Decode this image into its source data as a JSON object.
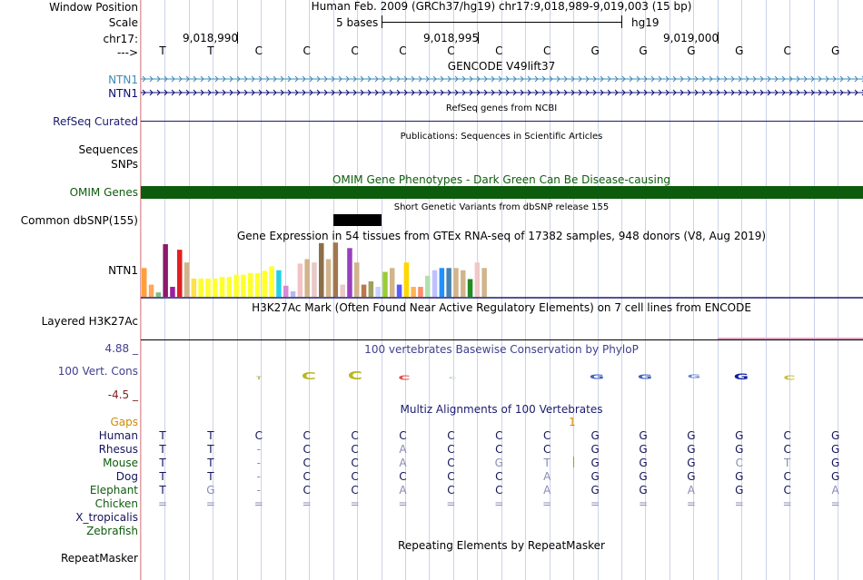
{
  "labels": {
    "window_position": "Window Position",
    "scale": "Scale",
    "chrom": "chr17:",
    "strand": "--->",
    "ntn1_a": "NTN1",
    "ntn1_b": "NTN1",
    "refseq": "RefSeq Curated",
    "sequences": "Sequences",
    "snps": "SNPs",
    "omim": "OMIM Genes",
    "dbsnp": "Common dbSNP(155)",
    "gtex": "NTN1",
    "h3k27ac": "Layered H3K27Ac",
    "cons_max": "4.88 _",
    "cons": "100 Vert. Cons",
    "cons_min": "-4.5 _",
    "gaps": "Gaps",
    "repeatmasker": "RepeatMasker"
  },
  "header": {
    "position": "Human Feb. 2009 (GRCh37/hg19)   chr17:9,018,989-9,019,003 (15 bp)",
    "scale_text": "5 bases",
    "assembly": "hg19",
    "coords": [
      "9,018,990",
      "9,018,995",
      "9,019,000"
    ]
  },
  "bases": [
    "T",
    "T",
    "C",
    "C",
    "C",
    "C",
    "C",
    "C",
    "C",
    "G",
    "G",
    "G",
    "G",
    "C",
    "G"
  ],
  "titles": {
    "gencode": "GENCODE V49lift37",
    "refseq": "RefSeq genes from NCBI",
    "pubs": "Publications: Sequences in Scientific Articles",
    "omim": "OMIM Gene Phenotypes - Dark Green Can Be Disease-causing",
    "dbsnp": "Short Genetic Variants from dbSNP release 155",
    "gtex": "Gene Expression in 54 tissues from GTEx RNA-seq of 17382 samples, 948 donors (V8, Aug 2019)",
    "h3k27ac": "H3K27Ac Mark (Often Found Near Active Regulatory Elements) on 7 cell lines from ENCODE",
    "phylop": "100 vertebrates Basewise Conservation by PhyloP",
    "multiz": "Multiz Alignments of 100 Vertebrates",
    "repeat": "Repeating Elements by RepeatMasker"
  },
  "colors": {
    "ntn1_light": "#3f8ab9",
    "ntn1_dark": "#0c0c78",
    "navy": "#1a1a6e",
    "omim": "#0d5c0d",
    "gaps": "#d18a00",
    "cons_max": "#3f3f8f",
    "cons_min": "#7f2020"
  },
  "gaps_marker": "1",
  "alignment": [
    {
      "species": "Human",
      "color": "#14145a",
      "bases": [
        "T",
        "T",
        "C",
        "C",
        "C",
        "C",
        "C",
        "C",
        "C",
        "G",
        "G",
        "G",
        "G",
        "C",
        "G"
      ]
    },
    {
      "species": "Rhesus",
      "color": "#14145a",
      "bases": [
        "T",
        "T",
        "-",
        "C",
        "C",
        "A",
        "C",
        "C",
        "C",
        "G",
        "G",
        "G",
        "G",
        "C",
        "G"
      ]
    },
    {
      "species": "Mouse",
      "color": "#0d5c0d",
      "bases": [
        "T",
        "T",
        "-",
        "C",
        "C",
        "A",
        "C",
        "G",
        "T",
        "G",
        "G",
        "G",
        "C",
        "T",
        "G"
      ]
    },
    {
      "species": "Dog",
      "color": "#14145a",
      "bases": [
        "T",
        "T",
        "-",
        "C",
        "C",
        "C",
        "C",
        "C",
        "A",
        "G",
        "G",
        "G",
        "G",
        "C",
        "G"
      ]
    },
    {
      "species": "Elephant",
      "color": "#0d5c0d",
      "bases": [
        "T",
        "G",
        "-",
        "C",
        "C",
        "A",
        "C",
        "C",
        "A",
        "G",
        "G",
        "A",
        "G",
        "C",
        "A"
      ]
    },
    {
      "species": "Chicken",
      "color": "#0d5c0d",
      "bases": [
        "=",
        "=",
        "=",
        "=",
        "=",
        "=",
        "=",
        "=",
        "=",
        "=",
        "=",
        "=",
        "=",
        "=",
        "="
      ]
    },
    {
      "species": "X_tropicalis",
      "color": "#14145a",
      "bases": []
    },
    {
      "species": "Zebrafish",
      "color": "#0d5c0d",
      "bases": []
    }
  ],
  "gtex_bars": [
    {
      "v": 0.52,
      "c": "#ff9f3c"
    },
    {
      "v": 0.22,
      "c": "#ffa65a"
    },
    {
      "v": 0.08,
      "c": "#7fbf7f"
    },
    {
      "v": 0.95,
      "c": "#8b1a6b"
    },
    {
      "v": 0.18,
      "c": "#9e1f9e"
    },
    {
      "v": 0.85,
      "c": "#e32020"
    },
    {
      "v": 0.62,
      "c": "#d2b48c"
    },
    {
      "v": 0.33,
      "c": "#ffe14a"
    },
    {
      "v": 0.33,
      "c": "#ffff2e"
    },
    {
      "v": 0.33,
      "c": "#ffff2e"
    },
    {
      "v": 0.33,
      "c": "#ffff2e"
    },
    {
      "v": 0.36,
      "c": "#ffff2e"
    },
    {
      "v": 0.36,
      "c": "#ffff2e"
    },
    {
      "v": 0.4,
      "c": "#ffff2e"
    },
    {
      "v": 0.4,
      "c": "#ffff2e"
    },
    {
      "v": 0.43,
      "c": "#ffff2e"
    },
    {
      "v": 0.43,
      "c": "#ffff2e"
    },
    {
      "v": 0.47,
      "c": "#ffff2e"
    },
    {
      "v": 0.55,
      "c": "#ffff2e"
    },
    {
      "v": 0.48,
      "c": "#24d0e8"
    },
    {
      "v": 0.2,
      "c": "#d68ad6"
    },
    {
      "v": 0.1,
      "c": "#b8b8e8"
    },
    {
      "v": 0.6,
      "c": "#f3c3c3"
    },
    {
      "v": 0.68,
      "c": "#d2b48c"
    },
    {
      "v": 0.62,
      "c": "#e8c8c8"
    },
    {
      "v": 0.97,
      "c": "#8b6f4a"
    },
    {
      "v": 0.68,
      "c": "#d2b48c"
    },
    {
      "v": 0.98,
      "c": "#a07850"
    },
    {
      "v": 0.22,
      "c": "#e8c8c8"
    },
    {
      "v": 0.88,
      "c": "#9a3fbf"
    },
    {
      "v": 0.62,
      "c": "#d2b48c"
    },
    {
      "v": 0.22,
      "c": "#b87a4a"
    },
    {
      "v": 0.28,
      "c": "#a0a060"
    },
    {
      "v": 0.18,
      "c": "#c8d2ff"
    },
    {
      "v": 0.45,
      "c": "#9acd32"
    },
    {
      "v": 0.52,
      "c": "#d2b48c"
    },
    {
      "v": 0.22,
      "c": "#5a5aff"
    },
    {
      "v": 0.62,
      "c": "#ffd700"
    },
    {
      "v": 0.18,
      "c": "#ffb450"
    },
    {
      "v": 0.18,
      "c": "#ff8c64"
    },
    {
      "v": 0.38,
      "c": "#b0e0b0"
    },
    {
      "v": 0.48,
      "c": "#c0c0ff"
    },
    {
      "v": 0.52,
      "c": "#1e90ff"
    },
    {
      "v": 0.52,
      "c": "#4682b4"
    },
    {
      "v": 0.52,
      "c": "#d2b48c"
    },
    {
      "v": 0.48,
      "c": "#d2b48c"
    },
    {
      "v": 0.32,
      "c": "#228b22"
    },
    {
      "v": 0.62,
      "c": "#f0c8c8"
    },
    {
      "v": 0.52,
      "c": "#d2b48c"
    }
  ]
}
